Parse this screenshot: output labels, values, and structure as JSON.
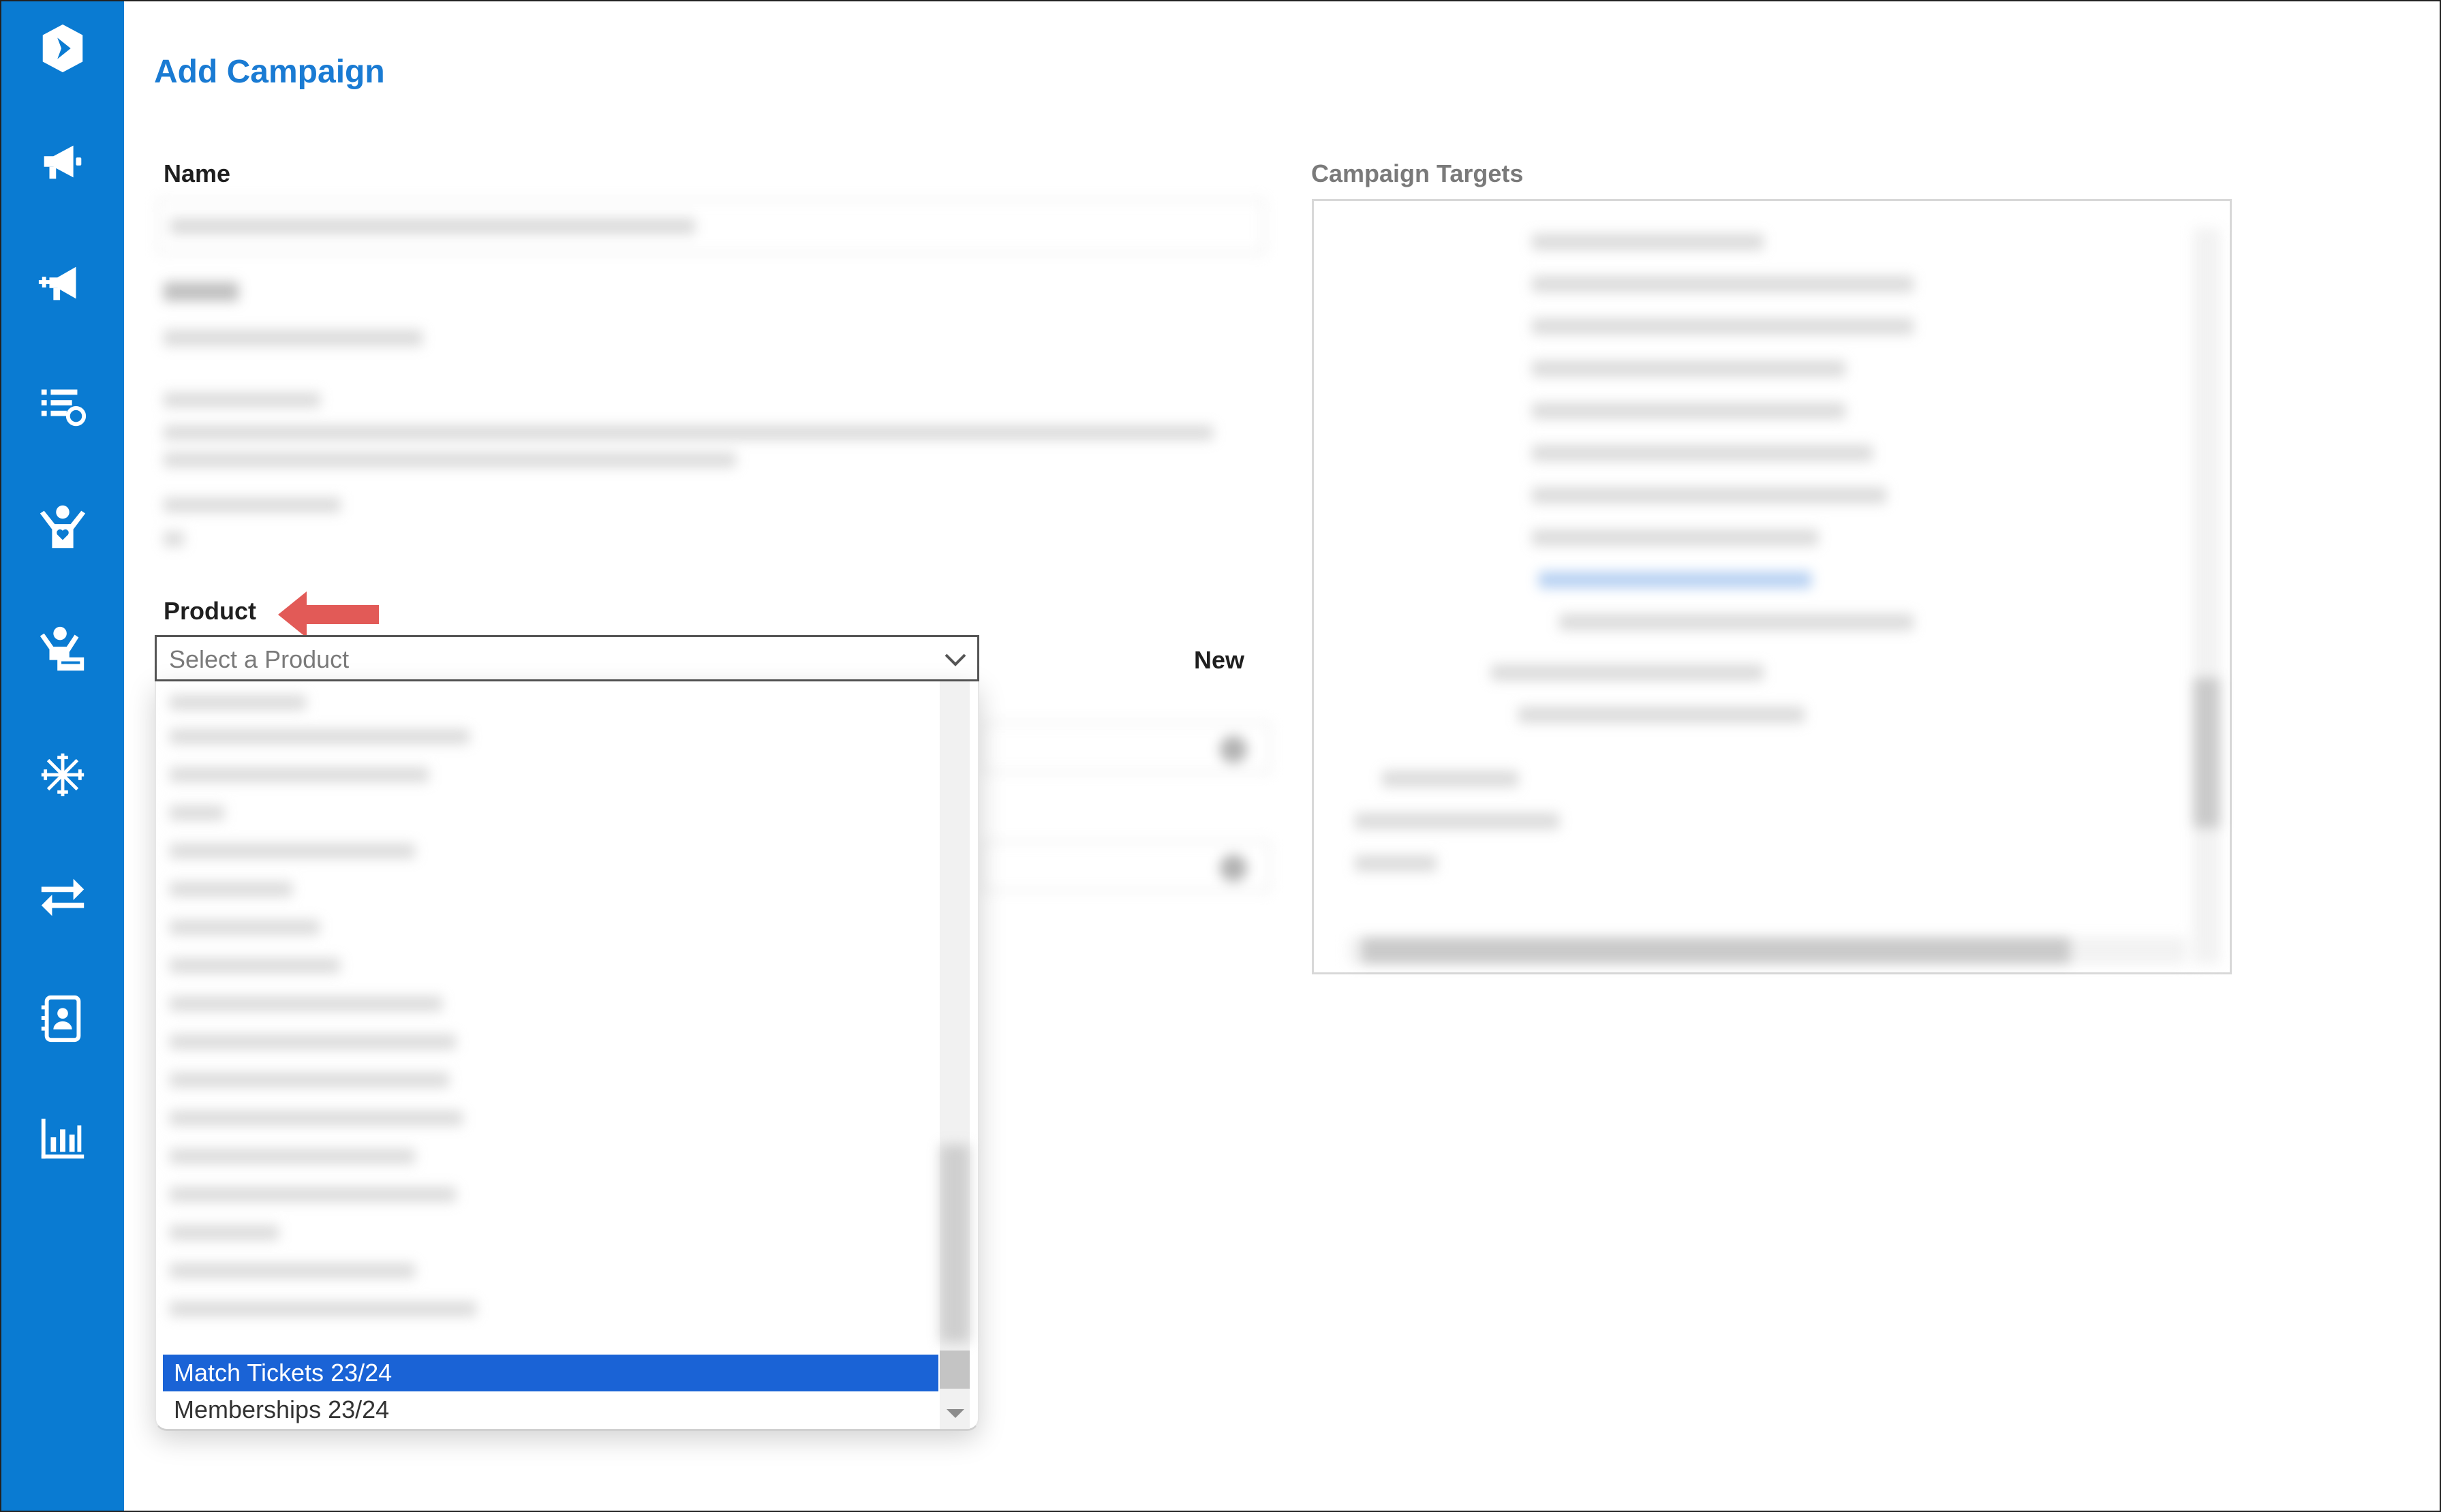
{
  "app": {
    "title": "Add Campaign"
  },
  "sidebar": {
    "items": [
      {
        "icon": "logo-icon"
      },
      {
        "icon": "megaphone-icon"
      },
      {
        "icon": "megaphone-add-icon"
      },
      {
        "icon": "list-settings-icon"
      },
      {
        "icon": "person-heart-icon"
      },
      {
        "icon": "person-badge-icon"
      },
      {
        "icon": "snowflake-icon"
      },
      {
        "icon": "swap-arrows-icon"
      },
      {
        "icon": "contact-card-icon"
      },
      {
        "icon": "bar-chart-icon"
      }
    ]
  },
  "form": {
    "name_label": "Name",
    "product_label": "Product",
    "product_placeholder": "Select a Product",
    "new_label": "New",
    "targets_label": "Campaign Targets"
  },
  "dropdown": {
    "selected_option": "Match Tickets 23/24",
    "next_option": "Memberships 23/24"
  },
  "colors": {
    "sidebar": "#0a7bd2",
    "accent": "#1a7bd3",
    "selected_option": "#1a63d6",
    "callout_arrow": "#e25a57"
  }
}
